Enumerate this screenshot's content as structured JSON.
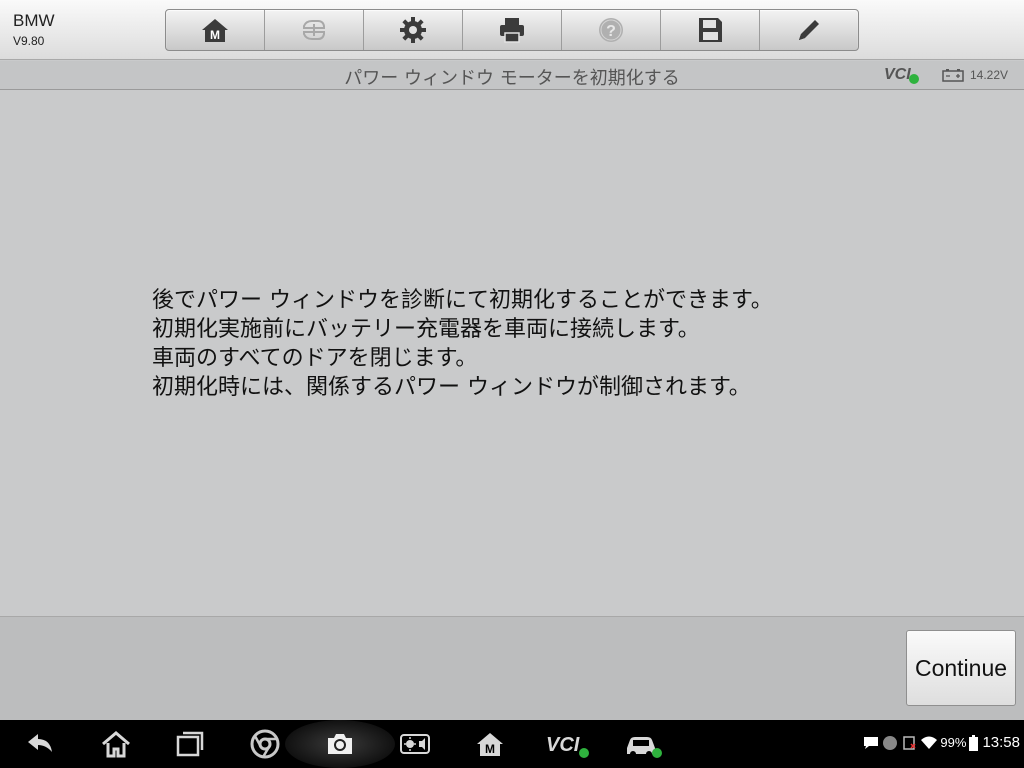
{
  "app": {
    "brand": "BMW",
    "version": "V9.80"
  },
  "toolbar": {
    "items": [
      {
        "icon": "autel-home-icon",
        "enabled": true
      },
      {
        "icon": "vehicle-swap-icon",
        "enabled": false
      },
      {
        "icon": "gear-icon",
        "enabled": true
      },
      {
        "icon": "printer-icon",
        "enabled": true
      },
      {
        "icon": "help-icon",
        "enabled": false
      },
      {
        "icon": "save-icon",
        "enabled": true
      },
      {
        "icon": "pencil-icon",
        "enabled": true
      }
    ]
  },
  "titlebar": {
    "title": "パワー ウィンドウ モーターを初期化する",
    "vci": "VCI",
    "voltage": "14.22V"
  },
  "main": {
    "lines": [
      "後でパワー ウィンドウを診断にて初期化することができます。",
      "初期化実施前にバッテリー充電器を車両に接続します。",
      "車両のすべてのドアを閉じます。",
      "初期化時には、関係するパワー ウィンドウが制御されます。"
    ]
  },
  "actions": {
    "continue_label": "Continue"
  },
  "navbar": {
    "icons": [
      "back-icon",
      "home-icon",
      "recent-apps-icon",
      "chrome-icon",
      "camera-icon",
      "brightness-icon",
      "autel-home-icon",
      "vci-icon",
      "car-icon"
    ],
    "vci_label": "VCI"
  },
  "status": {
    "battery": "99%",
    "time": "13:58"
  },
  "colors": {
    "accent_green": "#2fb33e",
    "background": "#c9cacb"
  }
}
